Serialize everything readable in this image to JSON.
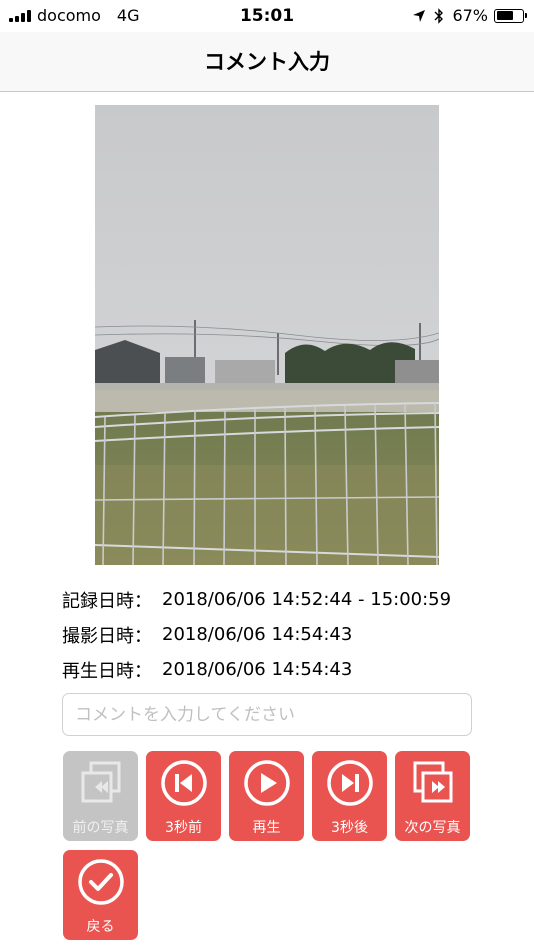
{
  "status_bar": {
    "carrier": "docomo",
    "network": "4G",
    "time": "15:01",
    "battery": "67%",
    "battery_level": 0.67
  },
  "nav": {
    "title": "コメント入力"
  },
  "photo": {
    "icon": "photo"
  },
  "info": {
    "record_label": "記録日時：",
    "record_value": "2018/06/06 14:52:44 - 15:00:59",
    "shoot_label": "撮影日時：",
    "shoot_value": "2018/06/06 14:54:43",
    "play_label": "再生日時：",
    "play_value": "2018/06/06 14:54:43"
  },
  "comment": {
    "placeholder": "コメントを入力してください",
    "value": ""
  },
  "buttons": {
    "prev_photo": "前の写真",
    "back3": "3秒前",
    "play": "再生",
    "forward3": "3秒後",
    "next_photo": "次の写真",
    "return": "戻る"
  },
  "colors": {
    "accent": "#ea5450",
    "disabled": "#c4c4c4"
  }
}
